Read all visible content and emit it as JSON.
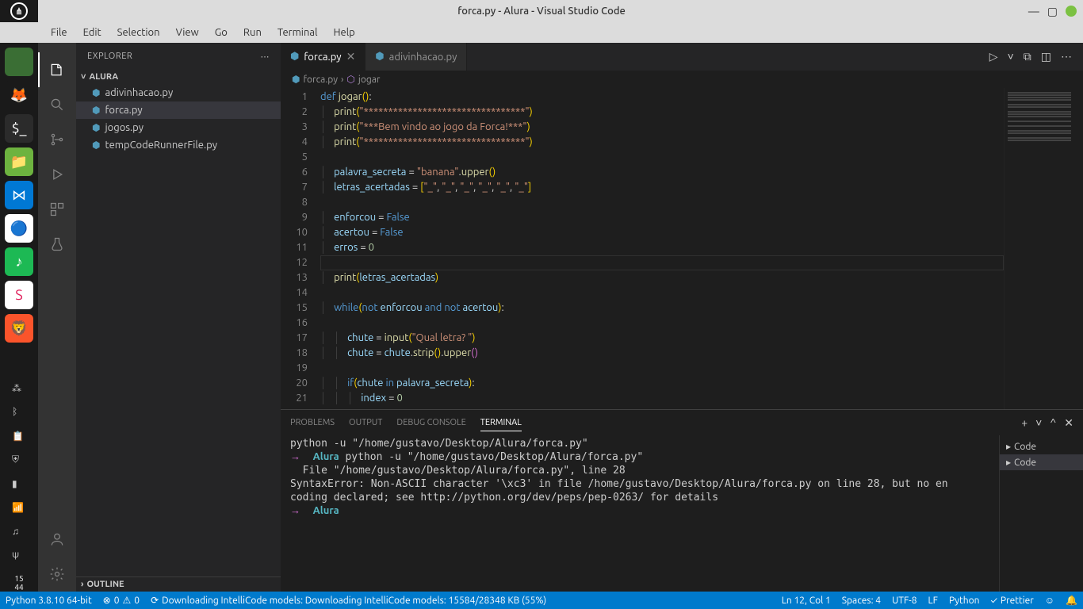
{
  "window": {
    "title": "forca.py - Alura - Visual Studio Code"
  },
  "menu": [
    "File",
    "Edit",
    "Selection",
    "View",
    "Go",
    "Run",
    "Terminal",
    "Help"
  ],
  "activity": {
    "items": [
      "explorer",
      "search",
      "source-control",
      "run-debug",
      "extensions",
      "testing"
    ]
  },
  "sidebar": {
    "title": "EXPLORER",
    "project": "ALURA",
    "files": [
      {
        "name": "adivinhacao.py"
      },
      {
        "name": "forca.py"
      },
      {
        "name": "jogos.py"
      },
      {
        "name": "tempCodeRunnerFile.py"
      }
    ],
    "outline": "OUTLINE"
  },
  "tabs": [
    {
      "name": "forca.py",
      "active": true
    },
    {
      "name": "adivinhacao.py",
      "active": false
    }
  ],
  "breadcrumb": {
    "file": "forca.py",
    "symbol": "jogar"
  },
  "code": {
    "current_line": 12,
    "lines": [
      {
        "n": 1,
        "html": "<span class='k-def'>def</span> <span class='k-func'>jogar</span><span class='k-par'>()</span>:"
      },
      {
        "n": 2,
        "html": "    <span class='k-func'>print</span><span class='k-par'>(</span><span class='k-str'>\"*********************************\"</span><span class='k-par'>)</span>"
      },
      {
        "n": 3,
        "html": "    <span class='k-func'>print</span><span class='k-par'>(</span><span class='k-str'>\"***Bem vindo ao jogo da Forca!***\"</span><span class='k-par'>)</span>"
      },
      {
        "n": 4,
        "html": "    <span class='k-func'>print</span><span class='k-par'>(</span><span class='k-str'>\"*********************************\"</span><span class='k-par'>)</span>"
      },
      {
        "n": 5,
        "html": ""
      },
      {
        "n": 6,
        "html": "    <span class='k-var'>palavra_secreta</span> <span class='k-op'>=</span> <span class='k-str'>\"banana\"</span>.<span class='k-func'>upper</span><span class='k-par'>()</span>"
      },
      {
        "n": 7,
        "html": "    <span class='k-var'>letras_acertadas</span> <span class='k-op'>=</span> <span class='k-par'>[</span><span class='k-str'>\"_\"</span>, <span class='k-str'>\"_\"</span>, <span class='k-str'>\"_\"</span>, <span class='k-str'>\"_\"</span>, <span class='k-str'>\"_\"</span>, <span class='k-str'>\"_\"</span><span class='k-par'>]</span>"
      },
      {
        "n": 8,
        "html": ""
      },
      {
        "n": 9,
        "html": "    <span class='k-var'>enforcou</span> <span class='k-op'>=</span> <span class='k-const'>False</span>"
      },
      {
        "n": 10,
        "html": "    <span class='k-var'>acertou</span> <span class='k-op'>=</span> <span class='k-const'>False</span>"
      },
      {
        "n": 11,
        "html": "    <span class='k-var'>erros</span> <span class='k-op'>=</span> <span class='k-num'>0</span>"
      },
      {
        "n": 12,
        "html": ""
      },
      {
        "n": 13,
        "html": "    <span class='k-func'>print</span><span class='k-par'>(</span><span class='k-var'>letras_acertadas</span><span class='k-par'>)</span>"
      },
      {
        "n": 14,
        "html": ""
      },
      {
        "n": 15,
        "html": "    <span class='k-def'>while</span><span class='k-par'>(</span><span class='k-def'>not</span> <span class='k-var'>enforcou</span> <span class='k-def'>and</span> <span class='k-def'>not</span> <span class='k-var'>acertou</span><span class='k-par'>)</span>:"
      },
      {
        "n": 16,
        "html": ""
      },
      {
        "n": 17,
        "html": "        <span class='k-var'>chute</span> <span class='k-op'>=</span> <span class='k-func'>input</span><span class='k-par'>(</span><span class='k-str'>\"Qual letra? \"</span><span class='k-par'>)</span>"
      },
      {
        "n": 18,
        "html": "        <span class='k-var'>chute</span> <span class='k-op'>=</span> <span class='k-var'>chute</span>.<span class='k-func'>strip</span><span class='k-par'>()</span>.<span class='k-func'>upper</span><span class='k-par2'>()</span>"
      },
      {
        "n": 19,
        "html": ""
      },
      {
        "n": 20,
        "html": "        <span class='k-def'>if</span><span class='k-par'>(</span><span class='k-var'>chute</span> <span class='k-def'>in</span> <span class='k-var'>palavra_secreta</span><span class='k-par'>)</span>:"
      },
      {
        "n": 21,
        "html": "            <span class='k-var'>index</span> <span class='k-op'>=</span> <span class='k-num'>0</span>"
      }
    ]
  },
  "panel": {
    "tabs": [
      "PROBLEMS",
      "OUTPUT",
      "DEBUG CONSOLE",
      "TERMINAL"
    ],
    "active": "TERMINAL",
    "terminal_output": "python -u \"/home/gustavo/Desktop/Alura/forca.py\"\n<span class='term-arrow'>→</span>  <span class='term-cwd'>Alura</span> python -u \"/home/gustavo/Desktop/Alura/forca.py\"\n  File \"/home/gustavo/Desktop/Alura/forca.py\", line 28\nSyntaxError: Non-ASCII character '\\xc3' in file /home/gustavo/Desktop/Alura/forca.py on line 28, but no en\ncoding declared; see http://python.org/dev/peps/pep-0263/ for details\n<span class='term-arrow'>→</span>  <span class='term-cwd'>Alura</span> ",
    "terminal_side": [
      {
        "name": "Code"
      },
      {
        "name": "Code"
      }
    ]
  },
  "status": {
    "python": "Python 3.8.10 64-bit",
    "errors": "0",
    "warnings": "0",
    "sync": "Downloading IntelliCode models: Downloading IntelliCode models: 15584/28348 KB (55%)",
    "ln": "Ln 12, Col 1",
    "spaces": "Spaces: 4",
    "encoding": "UTF-8",
    "eol": "LF",
    "lang": "Python",
    "prettier": "Prettier"
  },
  "dock_clock": {
    "a": "15",
    "b": "44"
  }
}
